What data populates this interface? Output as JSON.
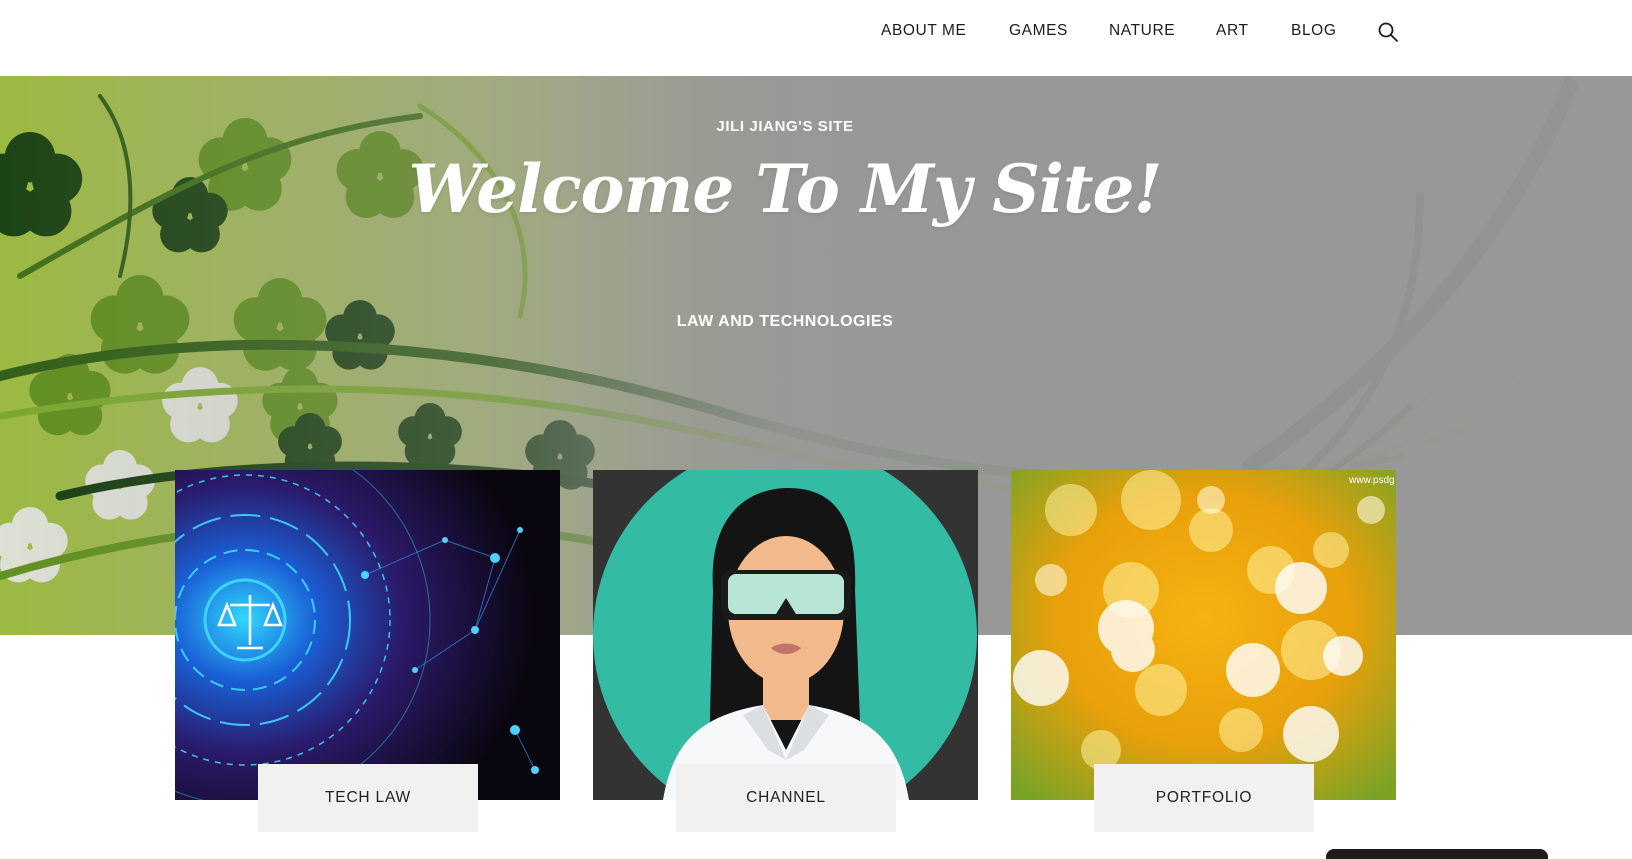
{
  "nav": {
    "items": [
      {
        "label": "ABOUT ME"
      },
      {
        "label": "GAMES"
      },
      {
        "label": "NATURE"
      },
      {
        "label": "ART"
      },
      {
        "label": "BLOG"
      }
    ],
    "search_icon": "search-icon"
  },
  "hero": {
    "site_name": "JILI JIANG'S SITE",
    "headline": "Welcome To My Site!",
    "tagline": "LAW AND TECHNOLOGIES"
  },
  "cards": [
    {
      "label": "TECH LAW"
    },
    {
      "label": "CHANNEL"
    },
    {
      "label": "PORTFOLIO",
      "watermark": "www.psdg"
    }
  ],
  "colors": {
    "hero_gray": "#9a9a9a",
    "leaf_green": "#6a9a1f",
    "dark_green": "#123a0c",
    "label_bg": "#f2f1ef",
    "avatar_teal": "#33bba4"
  }
}
